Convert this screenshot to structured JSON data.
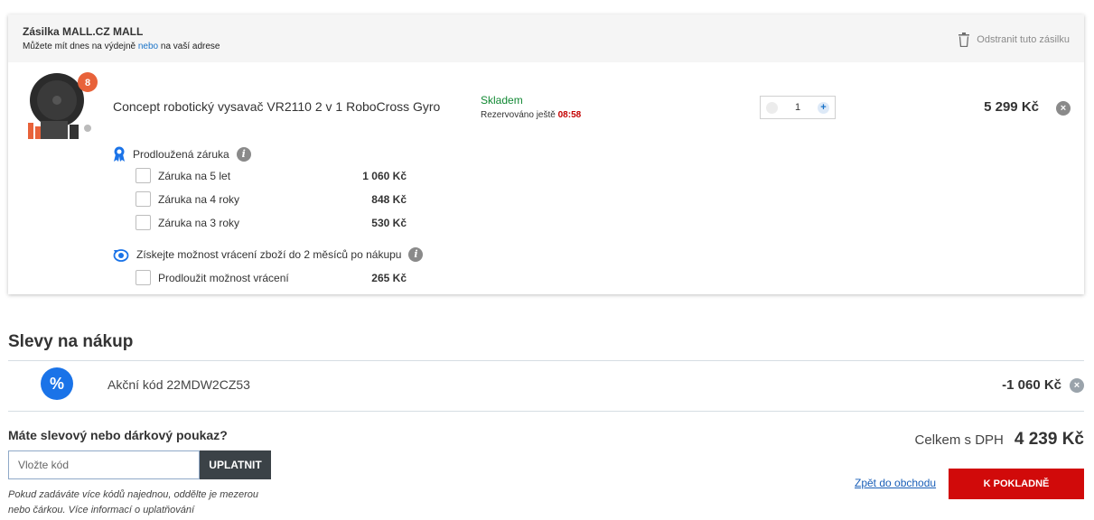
{
  "shipment": {
    "title": "Zásilka MALL.CZ MALL",
    "subtitle_pre": "Můžete mít dnes na výdejně ",
    "subtitle_link": "nebo",
    "subtitle_post": " na vaší adrese",
    "remove_label": "Odstranit tuto zásilku"
  },
  "product": {
    "name": "Concept robotický vysavač VR2110 2 v 1 RoboCross Gyro",
    "badge": "8",
    "stock": "Skladem",
    "reserved_label": "Rezervováno ještě ",
    "reserved_time": "08:58",
    "quantity": "1",
    "plus": "+",
    "price": "5 299 Kč",
    "remove": "×"
  },
  "warranty": {
    "title": "Prodloužená záruka",
    "info": "i",
    "options": [
      {
        "label": "Záruka na 5 let",
        "price": "1 060 Kč"
      },
      {
        "label": "Záruka na 4 roky",
        "price": "848 Kč"
      },
      {
        "label": "Záruka na 3 roky",
        "price": "530 Kč"
      }
    ]
  },
  "returns": {
    "title": "Získejte možnost vrácení zboží do 2 měsíců po nákupu",
    "info": "i",
    "option": {
      "label": "Prodloužit možnost vrácení",
      "price": "265 Kč"
    }
  },
  "discounts": {
    "title": "Slevy na nákup",
    "symbol": "%",
    "code_name": "Akční kód 22MDW2CZ53",
    "code_value": "-1 060 Kč",
    "remove": "×"
  },
  "voucher": {
    "title": "Máte slevový nebo dárkový poukaz?",
    "placeholder": "Vložte kód",
    "apply_label": "UPLATNIT",
    "note": "Pokud zadáváte více kódů najednou, oddělte je mezerou nebo čárkou. Více informací o uplatňování"
  },
  "summary": {
    "total_label": "Celkem s DPH",
    "total_value": "4 239 Kč",
    "back_label": "Zpět do obchodu",
    "checkout_label": "K POKLADNĚ"
  },
  "colors": {
    "accent_blue": "#1a73e8",
    "checkout_red": "#d10a0a",
    "stock_green": "#118833",
    "timer_red": "#c40000"
  }
}
